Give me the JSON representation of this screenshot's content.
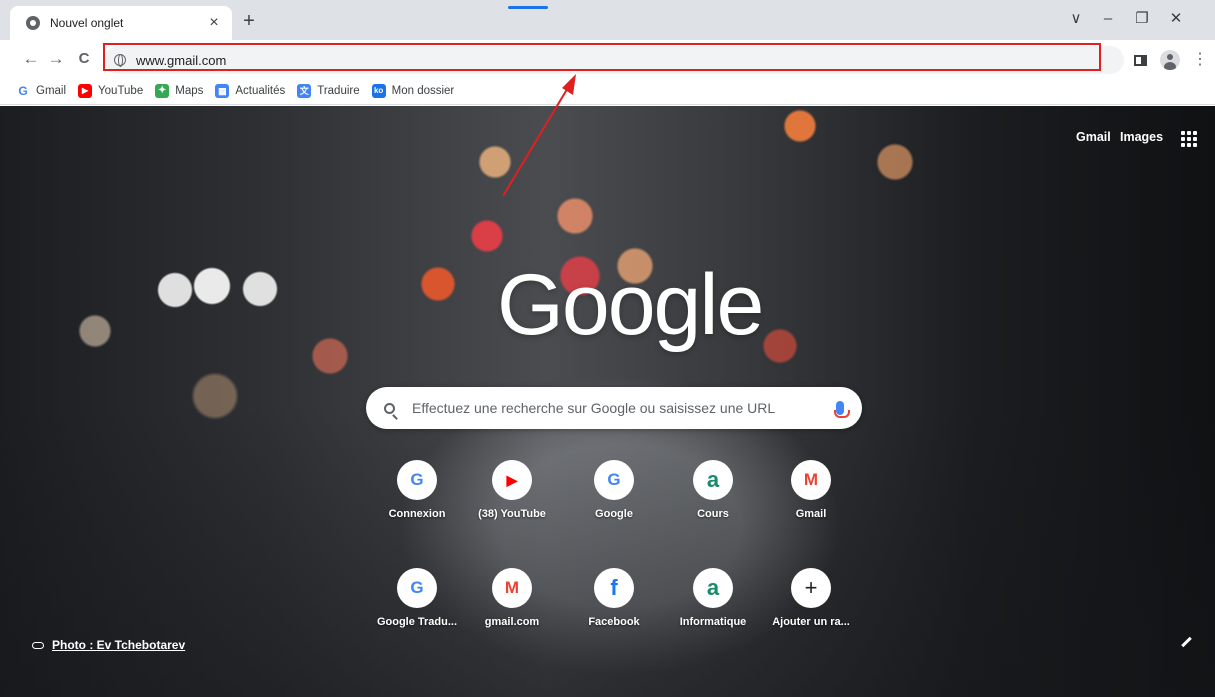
{
  "tab": {
    "title": "Nouvel onglet",
    "close": "×",
    "new_tab": "+"
  },
  "window_controls": {
    "tab_search": "∨",
    "minimize": "–",
    "restore": "❐",
    "close": "✕"
  },
  "toolbar": {
    "back": "←",
    "forward": "→",
    "reload": "C",
    "url": "www.gmail.com",
    "menu": "⋮"
  },
  "bookmarks": [
    {
      "label": "Gmail",
      "icon": "google-icon",
      "color": "#4285f4",
      "glyph": "G"
    },
    {
      "label": "YouTube",
      "icon": "youtube-icon",
      "color": "#ff0000",
      "glyph": "▶"
    },
    {
      "label": "Maps",
      "icon": "maps-icon",
      "color": "#34a853",
      "glyph": "✦"
    },
    {
      "label": "Actualités",
      "icon": "news-icon",
      "color": "#4285f4",
      "glyph": "▦"
    },
    {
      "label": "Traduire",
      "icon": "translate-icon",
      "color": "#4285f4",
      "glyph": "文"
    },
    {
      "label": "Mon dossier",
      "icon": "folder-icon",
      "color": "#1a73e8",
      "glyph": "ko"
    }
  ],
  "ntp": {
    "gmail_link": "Gmail",
    "images_link": "Images",
    "logo": "Google",
    "search_placeholder": "Effectuez une recherche sur Google ou saisissez une URL",
    "photo_credit": "Photo : Ev Tchebotarev"
  },
  "shortcuts": [
    {
      "label": "Connexion",
      "glyph": "G",
      "color": "#4285f4"
    },
    {
      "label": "(38) YouTube",
      "glyph": "▶",
      "color": "#ff0000"
    },
    {
      "label": "Google",
      "glyph": "G",
      "color": "#4285f4"
    },
    {
      "label": "Cours",
      "glyph": "a",
      "color": "#1a8a6e"
    },
    {
      "label": "Gmail",
      "glyph": "M",
      "color": "#ea4335"
    },
    {
      "label": "Google Tradu...",
      "glyph": "G",
      "color": "#4285f4"
    },
    {
      "label": "gmail.com",
      "glyph": "M",
      "color": "#ea4335"
    },
    {
      "label": "Facebook",
      "glyph": "f",
      "color": "#1877f2"
    },
    {
      "label": "Informatique",
      "glyph": "a",
      "color": "#1a8a6e"
    },
    {
      "label": "Ajouter un ra...",
      "glyph": "+",
      "color": "#202124"
    }
  ],
  "annotation_color": "#e02020"
}
